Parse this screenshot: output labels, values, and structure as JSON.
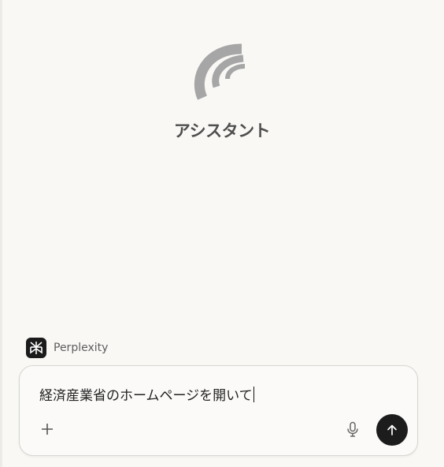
{
  "assistant": {
    "title": "アシスタント",
    "logo_icon": "wave-logo-icon",
    "logo_color": "#a6a6a6"
  },
  "model": {
    "name": "Perplexity",
    "icon": "perplexity-logo-icon"
  },
  "composer": {
    "input_value": "経済産業省のホームページを開いて",
    "add_icon": "plus-icon",
    "mic_icon": "microphone-icon",
    "send_icon": "arrow-up-icon",
    "send_color": "#1c1c1c"
  }
}
